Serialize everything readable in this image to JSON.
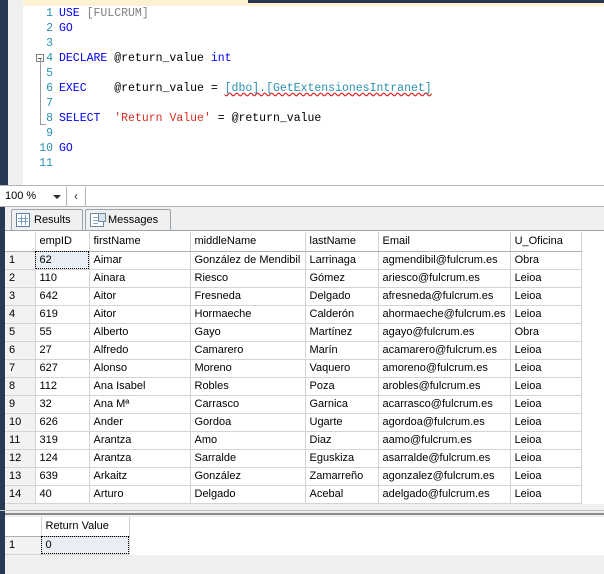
{
  "editor": {
    "zoom_level": "100 %",
    "lines": [
      {
        "num": "1",
        "tokens": [
          {
            "t": "USE",
            "c": "kw"
          },
          {
            "t": " ",
            "c": "punc"
          },
          {
            "t": "[FULCRUM]",
            "c": "br"
          }
        ]
      },
      {
        "num": "2",
        "tokens": [
          {
            "t": "GO",
            "c": "kw"
          }
        ]
      },
      {
        "num": "3",
        "tokens": []
      },
      {
        "num": "4",
        "tokens": [
          {
            "t": "DECLARE",
            "c": "kw"
          },
          {
            "t": " ",
            "c": "punc"
          },
          {
            "t": "@return_value",
            "c": "var"
          },
          {
            "t": " ",
            "c": "punc"
          },
          {
            "t": "int",
            "c": "type"
          }
        ]
      },
      {
        "num": "5",
        "tokens": []
      },
      {
        "num": "6",
        "tokens": [
          {
            "t": "EXEC",
            "c": "kw"
          },
          {
            "t": "    ",
            "c": "punc"
          },
          {
            "t": "@return_value",
            "c": "var"
          },
          {
            "t": " = ",
            "c": "punc"
          },
          {
            "t": "[dbo].[GetExtensionesIntranet]",
            "c": "obj wavy"
          }
        ]
      },
      {
        "num": "7",
        "tokens": []
      },
      {
        "num": "8",
        "tokens": [
          {
            "t": "SELECT",
            "c": "kw"
          },
          {
            "t": "  ",
            "c": "punc"
          },
          {
            "t": "'Return Value'",
            "c": "str"
          },
          {
            "t": " = ",
            "c": "punc"
          },
          {
            "t": "@return_value",
            "c": "var"
          }
        ]
      },
      {
        "num": "9",
        "tokens": []
      },
      {
        "num": "10",
        "tokens": [
          {
            "t": "GO",
            "c": "kw"
          }
        ]
      },
      {
        "num": "11",
        "tokens": []
      }
    ],
    "raw_text": "USE [FULCRUM]\nGO\n\nDECLARE @return_value int\n\nEXEC    @return_value = [dbo].[GetExtensionesIntranet]\n\nSELECT  'Return Value' = @return_value\n\nGO\n"
  },
  "tabs": [
    {
      "label": "Results",
      "icon": "grid-icon",
      "active": true
    },
    {
      "label": "Messages",
      "icon": "messages-icon",
      "active": false
    }
  ],
  "results_grid": {
    "columns": [
      "empID",
      "firstName",
      "middleName",
      "lastName",
      "Email",
      "U_Oficina"
    ],
    "rows": [
      {
        "n": "1",
        "empID": "62",
        "firstName": "Aimar",
        "middleName": "González de Mendibil",
        "lastName": "Larrinaga",
        "Email": "agmendibil@fulcrum.es",
        "U_Oficina": "Obra"
      },
      {
        "n": "2",
        "empID": "110",
        "firstName": "Ainara",
        "middleName": "Riesco",
        "lastName": "Gómez",
        "Email": "ariesco@fulcrum.es",
        "U_Oficina": "Leioa"
      },
      {
        "n": "3",
        "empID": "642",
        "firstName": "Aitor",
        "middleName": "Fresneda",
        "lastName": "Delgado",
        "Email": "afresneda@fulcrum.es",
        "U_Oficina": "Leioa"
      },
      {
        "n": "4",
        "empID": "619",
        "firstName": "Aitor",
        "middleName": "Hormaeche",
        "lastName": "Calderón",
        "Email": "ahormaeche@fulcrum.es",
        "U_Oficina": "Leioa"
      },
      {
        "n": "5",
        "empID": "55",
        "firstName": "Alberto",
        "middleName": "Gayo",
        "lastName": "Martínez",
        "Email": "agayo@fulcrum.es",
        "U_Oficina": "Obra"
      },
      {
        "n": "6",
        "empID": "27",
        "firstName": "Alfredo",
        "middleName": "Camarero",
        "lastName": "Marín",
        "Email": "acamarero@fulcrum.es",
        "U_Oficina": "Leioa"
      },
      {
        "n": "7",
        "empID": "627",
        "firstName": "Alonso",
        "middleName": "Moreno",
        "lastName": "Vaquero",
        "Email": "amoreno@fulcrum.es",
        "U_Oficina": "Leioa"
      },
      {
        "n": "8",
        "empID": "112",
        "firstName": "Ana Isabel",
        "middleName": "Robles",
        "lastName": "Poza",
        "Email": "arobles@fulcrum.es",
        "U_Oficina": "Leioa"
      },
      {
        "n": "9",
        "empID": "32",
        "firstName": "Ana Mª",
        "middleName": "Carrasco",
        "lastName": "Garnica",
        "Email": "acarrasco@fulcrum.es",
        "U_Oficina": "Leioa"
      },
      {
        "n": "10",
        "empID": "626",
        "firstName": "Ander",
        "middleName": "Gordoa",
        "lastName": "Ugarte",
        "Email": "agordoa@fulcrum.es",
        "U_Oficina": "Leioa"
      },
      {
        "n": "11",
        "empID": "319",
        "firstName": "Arantza",
        "middleName": "Amo",
        "lastName": "Diaz",
        "Email": "aamo@fulcrum.es",
        "U_Oficina": "Leioa"
      },
      {
        "n": "12",
        "empID": "124",
        "firstName": "Arantza",
        "middleName": "Sarralde",
        "lastName": "Eguskiza",
        "Email": "asarralde@fulcrum.es",
        "U_Oficina": "Leioa"
      },
      {
        "n": "13",
        "empID": "639",
        "firstName": "Arkaitz",
        "middleName": "González",
        "lastName": "Zamarreño",
        "Email": "agonzalez@fulcrum.es",
        "U_Oficina": "Leioa"
      },
      {
        "n": "14",
        "empID": "40",
        "firstName": "Arturo",
        "middleName": "Delgado",
        "lastName": "Acebal",
        "Email": "adelgado@fulcrum.es",
        "U_Oficina": "Leioa"
      }
    ]
  },
  "return_grid": {
    "columns": [
      "Return Value"
    ],
    "rows": [
      {
        "n": "1",
        "value": "0"
      }
    ]
  },
  "colors": {
    "keyword": "#0000ff",
    "string": "#d93025",
    "object": "#2b91af",
    "linenum": "#2b91af",
    "rail": "#293955",
    "selection": "#e8eef4"
  }
}
